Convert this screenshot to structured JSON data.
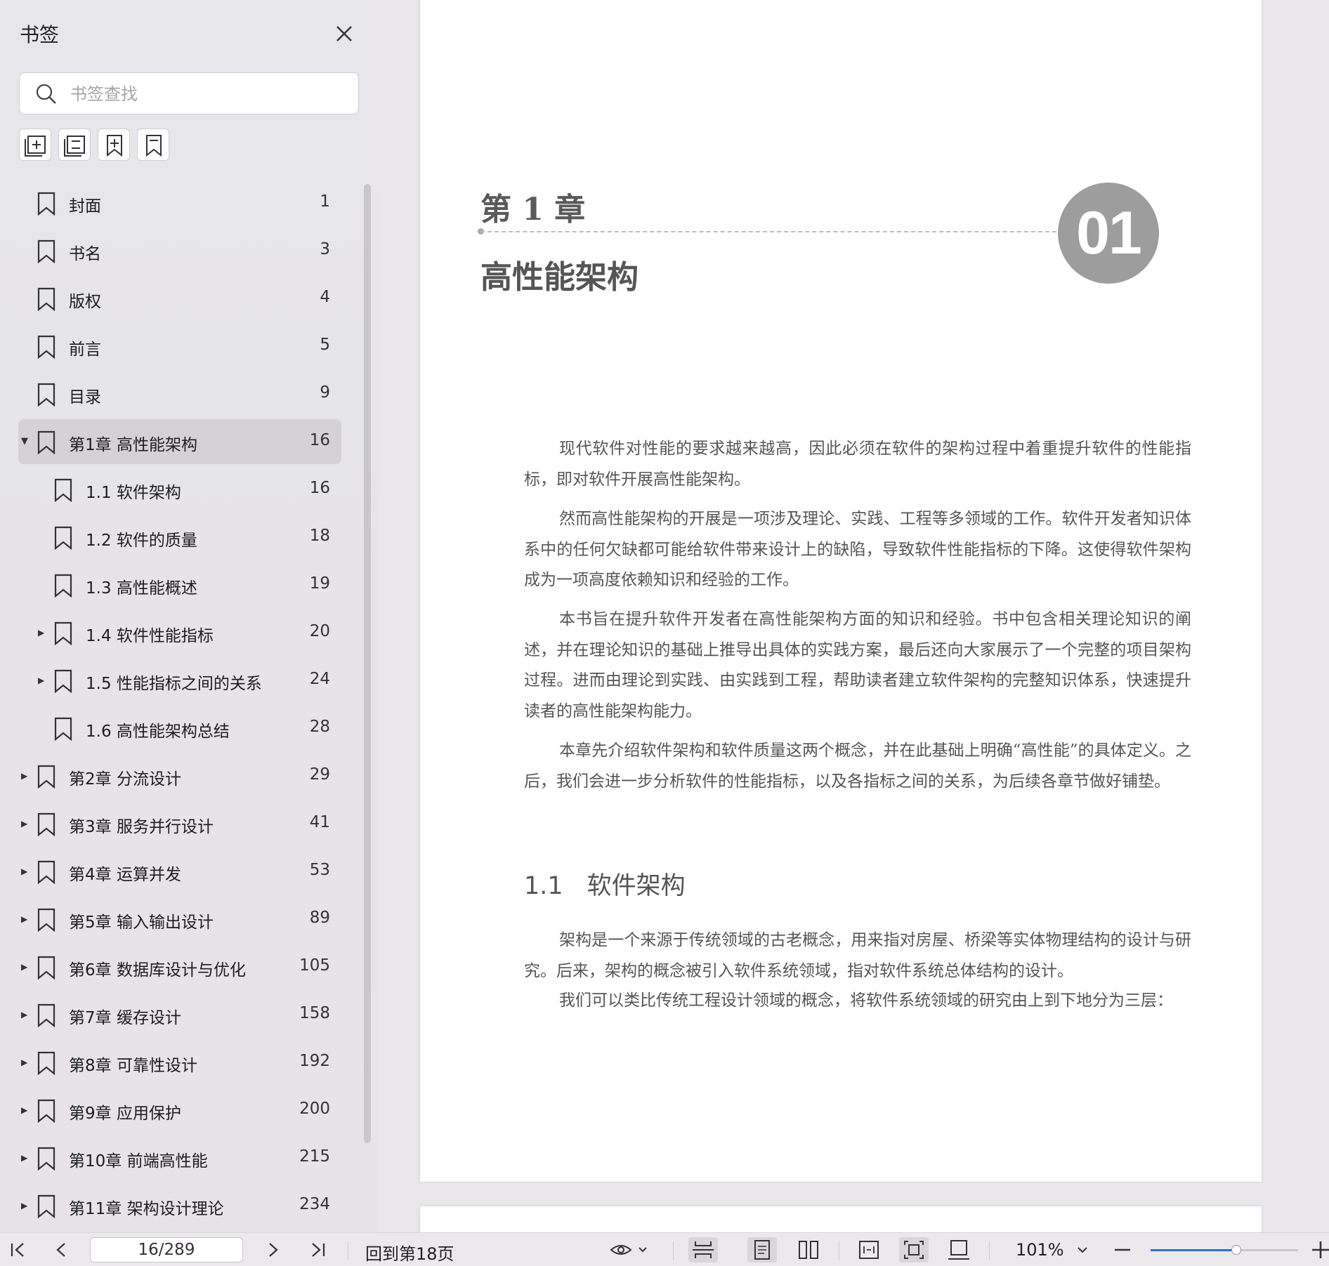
{
  "sidebar": {
    "title": "书签",
    "search_placeholder": "书签查找",
    "tools": [
      "expand-all-icon",
      "collapse-all-icon",
      "add-bookmark-icon",
      "bookmark-icon"
    ],
    "items": [
      {
        "label": "封面",
        "page": "1",
        "level": 0,
        "arrow": ""
      },
      {
        "label": "书名",
        "page": "3",
        "level": 0,
        "arrow": ""
      },
      {
        "label": "版权",
        "page": "4",
        "level": 0,
        "arrow": ""
      },
      {
        "label": "前言",
        "page": "5",
        "level": 0,
        "arrow": ""
      },
      {
        "label": "目录",
        "page": "9",
        "level": 0,
        "arrow": ""
      },
      {
        "label": "第1章 高性能架构",
        "page": "16",
        "level": 0,
        "arrow": "▼",
        "selected": true
      },
      {
        "label": "1.1 软件架构",
        "page": "16",
        "level": 1,
        "arrow": ""
      },
      {
        "label": "1.2 软件的质量",
        "page": "18",
        "level": 1,
        "arrow": ""
      },
      {
        "label": "1.3 高性能概述",
        "page": "19",
        "level": 1,
        "arrow": ""
      },
      {
        "label": "1.4 软件性能指标",
        "page": "20",
        "level": 1,
        "arrow": "▶"
      },
      {
        "label": "1.5 性能指标之间的关系",
        "page": "24",
        "level": 1,
        "arrow": "▶"
      },
      {
        "label": "1.6 高性能架构总结",
        "page": "28",
        "level": 1,
        "arrow": ""
      },
      {
        "label": "第2章 分流设计",
        "page": "29",
        "level": 0,
        "arrow": "▶"
      },
      {
        "label": "第3章 服务并行设计",
        "page": "41",
        "level": 0,
        "arrow": "▶"
      },
      {
        "label": "第4章 运算并发",
        "page": "53",
        "level": 0,
        "arrow": "▶"
      },
      {
        "label": "第5章 输入输出设计",
        "page": "89",
        "level": 0,
        "arrow": "▶"
      },
      {
        "label": "第6章 数据库设计与优化",
        "page": "105",
        "level": 0,
        "arrow": "▶"
      },
      {
        "label": "第7章 缓存设计",
        "page": "158",
        "level": 0,
        "arrow": "▶"
      },
      {
        "label": "第8章 可靠性设计",
        "page": "192",
        "level": 0,
        "arrow": "▶"
      },
      {
        "label": "第9章 应用保护",
        "page": "200",
        "level": 0,
        "arrow": "▶"
      },
      {
        "label": "第10章 前端高性能",
        "page": "215",
        "level": 0,
        "arrow": "▶"
      },
      {
        "label": "第11章 架构设计理论",
        "page": "234",
        "level": 0,
        "arrow": "▶"
      }
    ]
  },
  "document": {
    "chapter_label": "第 1 章",
    "chapter_title": "高性能架构",
    "chapter_number": "01",
    "paragraphs": [
      "现代软件对性能的要求越来越高，因此必须在软件的架构过程中着重提升软件的性能指标，即对软件开展高性能架构。",
      "然而高性能架构的开展是一项涉及理论、实践、工程等多领域的工作。软件开发者知识体系中的任何欠缺都可能给软件带来设计上的缺陷，导致软件性能指标的下降。这使得软件架构成为一项高度依赖知识和经验的工作。",
      "本书旨在提升软件开发者在高性能架构方面的知识和经验。书中包含相关理论知识的阐述，并在理论知识的基础上推导出具体的实践方案，最后还向大家展示了一个完整的项目架构过程。进而由理论到实践、由实践到工程，帮助读者建立软件架构的完整知识体系，快速提升读者的高性能架构能力。",
      "本章先介绍软件架构和软件质量这两个概念，并在此基础上明确“高性能”的具体定义。之后，我们会进一步分析软件的性能指标，以及各指标之间的关系，为后续各章节做好铺垫。"
    ],
    "section_number": "1.1",
    "section_title": "软件架构",
    "section_paragraphs": [
      "架构是一个来源于传统领域的古老概念，用来指对房屋、桥梁等实体物理结构的设计与研究。后来，架构的概念被引入软件系统领域，指对软件系统总体结构的设计。",
      "我们可以类比传统工程设计领域的概念，将软件系统领域的研究由上到下地分为三层："
    ]
  },
  "bottombar": {
    "page_value": "16/289",
    "back_link": "回到第18页",
    "zoom": "101%",
    "zoom_fraction": 0.58
  }
}
